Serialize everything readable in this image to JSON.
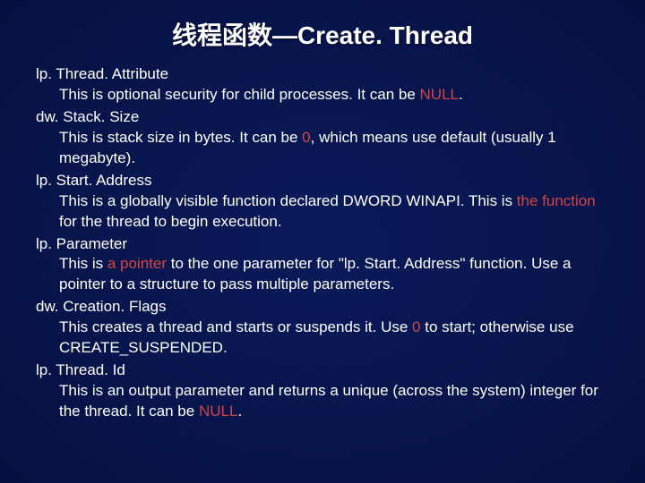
{
  "title": "线程函数—Create. Thread",
  "params": [
    {
      "name": "lp. Thread. Attribute",
      "desc_pre": "This is optional security for child processes. It can be ",
      "hl": "NULL",
      "desc_post": "."
    },
    {
      "name": "dw. Stack. Size",
      "desc_pre": "This is stack size in bytes. It can be ",
      "hl": "0",
      "desc_post": ", which means use default (usually 1 megabyte)."
    },
    {
      "name": "lp. Start. Address",
      "desc_pre": "This is a globally visible function declared DWORD WINAPI. This is ",
      "hl": "the function",
      "desc_post": " for the thread to begin execution."
    },
    {
      "name": "lp. Parameter",
      "desc_pre": "This is ",
      "hl": "a pointer",
      "desc_post": " to the one parameter for \"lp. Start. Address\" function. Use a pointer to a structure to pass multiple parameters."
    },
    {
      "name": "dw. Creation. Flags",
      "desc_pre": "This creates a thread and starts or suspends it. Use ",
      "hl": "0",
      "desc_post": " to start; otherwise use CREATE_SUSPENDED."
    },
    {
      "name": "lp. Thread. Id",
      "desc_pre": "This is an output parameter and returns a unique (across the system) integer for the thread. It can be ",
      "hl": "NULL",
      "desc_post": "."
    }
  ]
}
